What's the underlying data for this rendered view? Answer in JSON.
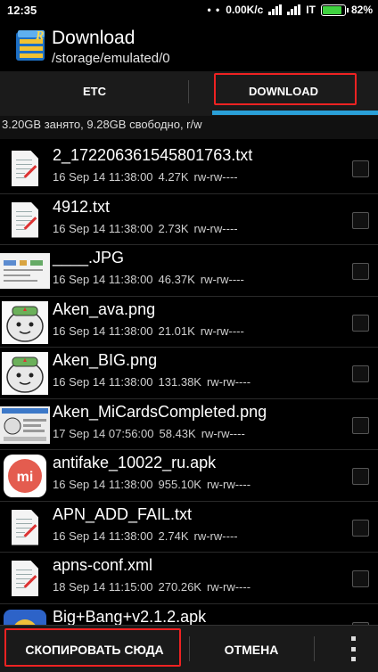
{
  "status": {
    "time": "12:35",
    "speed": "0.00K/c",
    "carrier": "IT",
    "battery": "82%",
    "battery_fraction": 0.82
  },
  "appbar": {
    "title": "Download",
    "path": "/storage/emulated/0",
    "icon": "root-explorer-folder-icon"
  },
  "tabs": [
    {
      "label": "ETC",
      "active": false
    },
    {
      "label": "DOWNLOAD",
      "active": true
    }
  ],
  "storage_info": "3.20GB занято, 9.28GB свободно, r/w",
  "files": [
    {
      "name": "2_172206361545801763.txt",
      "date": "16 Sep 14 11:38:00",
      "size": "4.27K",
      "perms": "rw-rw----",
      "thumb": "text-file-icon"
    },
    {
      "name": "4912.txt",
      "date": "16 Sep 14 11:38:00",
      "size": "2.73K",
      "perms": "rw-rw----",
      "thumb": "text-file-icon"
    },
    {
      "name": "____.JPG",
      "date": "16 Sep 14 11:38:00",
      "size": "46.37K",
      "perms": "rw-rw----",
      "thumb": "image-thumb"
    },
    {
      "name": "Aken_ava.png",
      "date": "16 Sep 14 11:38:00",
      "size": "21.01K",
      "perms": "rw-rw----",
      "thumb": "mascot-thumb"
    },
    {
      "name": "Aken_BIG.png",
      "date": "16 Sep 14 11:38:00",
      "size": "131.38K",
      "perms": "rw-rw----",
      "thumb": "mascot-thumb"
    },
    {
      "name": "Aken_MiCardsCompleted.png",
      "date": "17 Sep 14 07:56:00",
      "size": "58.43K",
      "perms": "rw-rw----",
      "thumb": "screenshot-thumb"
    },
    {
      "name": "antifake_10022_ru.apk",
      "date": "16 Sep 14 11:38:00",
      "size": "955.10K",
      "perms": "rw-rw----",
      "thumb": "mi-apk-icon"
    },
    {
      "name": "APN_ADD_FAIL.txt",
      "date": "16 Sep 14 11:38:00",
      "size": "2.74K",
      "perms": "rw-rw----",
      "thumb": "text-file-icon"
    },
    {
      "name": "apns-conf.xml",
      "date": "18 Sep 14 11:15:00",
      "size": "270.26K",
      "perms": "rw-rw----",
      "thumb": "text-file-icon"
    },
    {
      "name": "Big+Bang+v2.1.2.apk",
      "date": "",
      "size": "",
      "perms": "",
      "thumb": "game-apk-icon"
    }
  ],
  "actions": {
    "copy_here": "СКОПИРОВАТЬ СЮДА",
    "cancel": "ОТМЕНА"
  },
  "colors": {
    "accent": "#2aa0d8",
    "highlight": "#ee2222",
    "battery": "#3fd13f"
  }
}
